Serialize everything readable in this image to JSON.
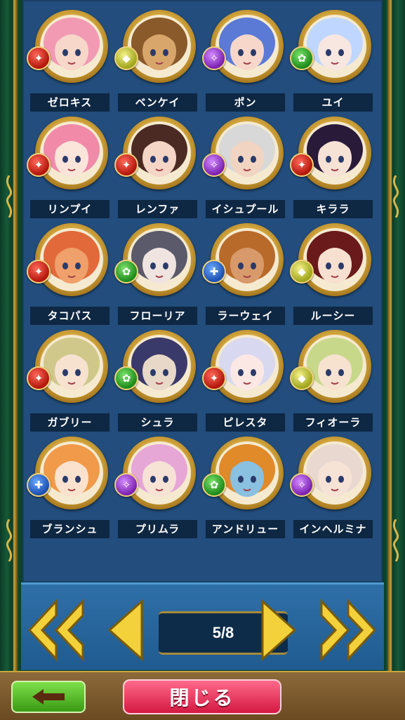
{
  "pager": {
    "page_label": "5/8"
  },
  "buttons": {
    "close_label": "閉じる"
  },
  "characters": [
    {
      "name": "ゼロキス",
      "attr": "red",
      "palette": [
        "#f29ab4",
        "#f7d7c9"
      ]
    },
    {
      "name": "ベンケイ",
      "attr": "yellow",
      "palette": [
        "#8a5a2a",
        "#d8a66a"
      ]
    },
    {
      "name": "ポン",
      "attr": "purple",
      "palette": [
        "#5a7ad6",
        "#f7d7c9"
      ]
    },
    {
      "name": "ユイ",
      "attr": "green",
      "palette": [
        "#bfd7ff",
        "#f7e7e0"
      ]
    },
    {
      "name": "リンプイ",
      "attr": "red",
      "palette": [
        "#f08aa8",
        "#fbe4da"
      ]
    },
    {
      "name": "レンファ",
      "attr": "red",
      "palette": [
        "#4a2a22",
        "#f5d6c6"
      ]
    },
    {
      "name": "イシュプール",
      "attr": "purple",
      "palette": [
        "#d8d8d8",
        "#f2d4c2"
      ]
    },
    {
      "name": "キララ",
      "attr": "red",
      "palette": [
        "#2a1a3a",
        "#f7e2d6"
      ]
    },
    {
      "name": "タコパス",
      "attr": "red",
      "palette": [
        "#e26a3a",
        "#f0a06a"
      ]
    },
    {
      "name": "フローリア",
      "attr": "green",
      "palette": [
        "#5a5a6a",
        "#f0e4e0"
      ]
    },
    {
      "name": "ラーウェイ",
      "attr": "blue",
      "palette": [
        "#b86a2a",
        "#d89a6a"
      ]
    },
    {
      "name": "ルーシー",
      "attr": "yellow",
      "palette": [
        "#6a1a1a",
        "#f7e0d0"
      ]
    },
    {
      "name": "ガブリー",
      "attr": "red",
      "palette": [
        "#cfc88a",
        "#f7e2d0"
      ]
    },
    {
      "name": "シュラ",
      "attr": "green",
      "palette": [
        "#3a3a6a",
        "#e8d8c8"
      ]
    },
    {
      "name": "ピレスタ",
      "attr": "red",
      "palette": [
        "#d8d8f0",
        "#fbe8e4"
      ]
    },
    {
      "name": "フィオーラ",
      "attr": "yellow",
      "palette": [
        "#c8d88a",
        "#f7e2d0"
      ]
    },
    {
      "name": "ブランシュ",
      "attr": "blue",
      "palette": [
        "#f09a4a",
        "#fbe2cf"
      ]
    },
    {
      "name": "プリムラ",
      "attr": "purple",
      "palette": [
        "#e6a6d6",
        "#f7e2d6"
      ]
    },
    {
      "name": "アンドリュー",
      "attr": "green",
      "palette": [
        "#e08a2a",
        "#8ac0e0"
      ]
    },
    {
      "name": "インヘルミナ",
      "attr": "purple",
      "palette": [
        "#e8d8d0",
        "#f7e2d6"
      ]
    }
  ]
}
